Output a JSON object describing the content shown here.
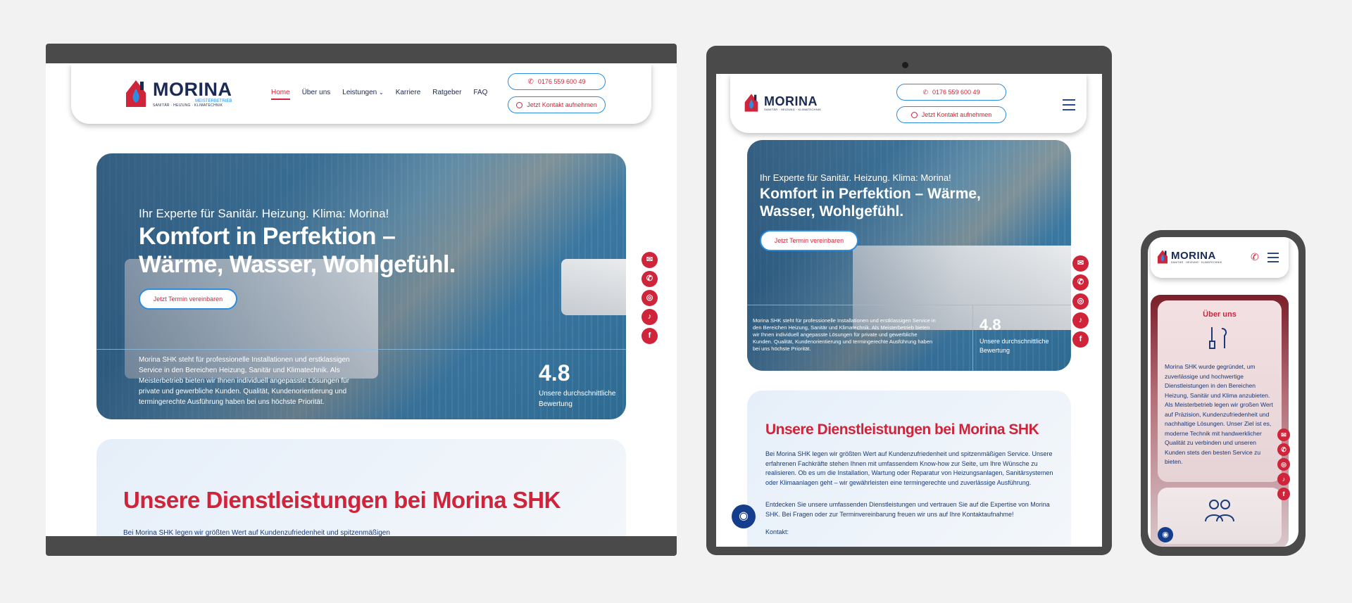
{
  "brand": {
    "name": "MORINA",
    "tagline": "MEISTERBETRIEB",
    "services_line": "SANITÄR · HEIZUNG · KLIMATECHNIK"
  },
  "nav": {
    "items": [
      {
        "label": "Home",
        "active": true
      },
      {
        "label": "Über uns"
      },
      {
        "label": "Leistungen"
      },
      {
        "label": "Karriere"
      },
      {
        "label": "Ratgeber"
      },
      {
        "label": "FAQ"
      }
    ]
  },
  "contact": {
    "phone": "0176 559 600 49",
    "cta": "Jetzt Kontakt aufnehmen"
  },
  "hero": {
    "eyebrow": "Ihr Experte für Sanitär. Heizung. Klima: Morina!",
    "title": "Komfort in Perfektion – Wärme, Wasser, Wohlgefühl.",
    "button": "Jetzt Termin vereinbaren",
    "description": "Morina SHK steht für professionelle Installationen und erstklassigen Service in den Bereichen Heizung, Sanitär und Klimatechnik. Als Meisterbetrieb bieten wir Ihnen individuell angepasste Lösungen für private und gewerbliche Kunden. Qualität, Kundenorientierung und termingerechte Ausführung haben bei uns höchste Priorität.",
    "rating": "4.8",
    "rating_label": "Unsere durchschnittliche Bewertung"
  },
  "services": {
    "title": "Unsere Dienstleistungen bei Morina SHK",
    "intro_short": "Bei Morina SHK legen wir größten Wert auf Kundenzufriedenheit und spitzenmäßigen",
    "intro": "Bei Morina SHK legen wir größten Wert auf Kundenzufriedenheit und spitzenmäßigen Service. Unsere erfahrenen Fachkräfte stehen Ihnen mit umfassendem Know-how zur Seite, um Ihre Wünsche zu realisieren. Ob es um die Installation, Wartung oder Reparatur von Heizungsanlagen, Sanitärsystemen oder Klimaanlagen geht – wir gewährleisten eine termingerechte und zuverlässige Ausführung.",
    "more": "Entdecken Sie unsere umfassenden Dienstleistungen und vertrauen Sie auf die Expertise von Morina SHK. Bei Fragen oder zur Terminvereinbarung freuen wir uns auf Ihre Kontaktaufnahme!",
    "contact_label": "Kontakt:"
  },
  "about": {
    "title": "Über uns",
    "text": "Morina SHK wurde gegründet, um zuverlässige und hochwertige Dienstleistungen in den Bereichen Heizung, Sanitär und Klima anzubieten. Als Meisterbetrieb legen wir großen Wert auf Präzision, Kundenzufriedenheit und nachhaltige Lösungen. Unser Ziel ist es, moderne Technik mit handwerklicher Qualität zu verbinden und unseren Kunden stets den besten Service zu bieten."
  },
  "social": {
    "icons": [
      "mail-icon",
      "phone-icon",
      "instagram-icon",
      "tiktok-icon",
      "facebook-icon"
    ],
    "glyphs": [
      "✉",
      "✆",
      "◎",
      "♪",
      "f"
    ]
  },
  "colors": {
    "accent": "#d0243a",
    "blue": "#2a8de0",
    "navy": "#1a2a55",
    "frame": "#4a4a4a"
  }
}
